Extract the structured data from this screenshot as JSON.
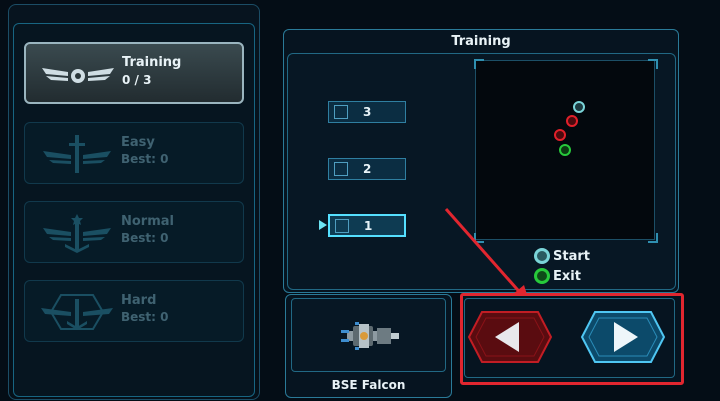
{
  "modes": [
    {
      "title": "Training",
      "sub": "0 / 3",
      "state": "selected",
      "emblem": "wings-emblem-icon"
    },
    {
      "title": "Easy",
      "sub": "Best: 0",
      "state": "locked",
      "emblem": "sword-wings-emblem-icon"
    },
    {
      "title": "Normal",
      "sub": "Best: 0",
      "state": "locked",
      "emblem": "star-wings-emblem-icon"
    },
    {
      "title": "Hard",
      "sub": "Best: 0",
      "state": "locked",
      "emblem": "hex-wings-emblem-icon"
    }
  ],
  "panel_title": "Training",
  "levels": [
    {
      "label": "3",
      "selected": false
    },
    {
      "label": "2",
      "selected": false
    },
    {
      "label": "1",
      "selected": true
    }
  ],
  "legend": {
    "start": "Start",
    "exit": "Exit"
  },
  "colors": {
    "start": "#7ad4d8",
    "hostile": "#e0202a",
    "exit": "#27c93b",
    "accent": "#55e0ff",
    "highlight": "#e1262f"
  },
  "ship": {
    "name": "BSE Falcon",
    "icon": "spaceship-icon"
  },
  "nav": {
    "prev_icon": "arrow-left-icon",
    "next_icon": "arrow-right-icon"
  }
}
